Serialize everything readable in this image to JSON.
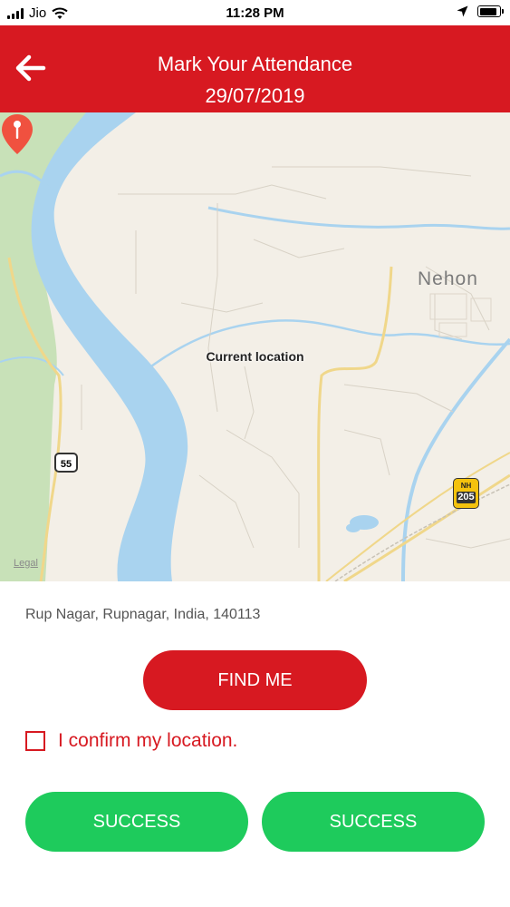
{
  "status_bar": {
    "carrier": "Jio",
    "time": "11:28 PM",
    "icons": [
      "signal-icon",
      "wifi-icon",
      "location-arrow-icon",
      "battery-icon"
    ]
  },
  "header": {
    "title": "Mark Your Attendance",
    "date": "29/07/2019",
    "back_icon": "arrow-left-icon"
  },
  "map": {
    "pin_label": "Current location",
    "place_label": "Nehon",
    "route_55": "55",
    "highway_prefix": "NH",
    "highway_number": "205",
    "legal": "Legal"
  },
  "address": "Rup Nagar, Rupnagar, India, 140113",
  "buttons": {
    "find_me": "FIND ME",
    "success_1": "SUCCESS",
    "success_2": "SUCCESS"
  },
  "confirm": {
    "label": "I confirm my location.",
    "checked": false
  },
  "colors": {
    "brand_red": "#d71921",
    "success_green": "#1ecb5c",
    "river_blue": "#a9d3ef",
    "forest_green": "#c8e1b8",
    "map_base": "#f3efe7",
    "road_yellow": "#f0d78a"
  }
}
